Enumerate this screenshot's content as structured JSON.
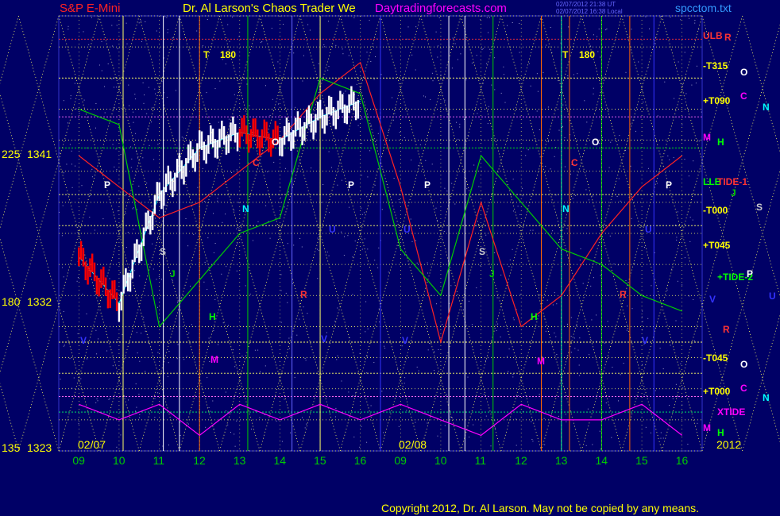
{
  "header": {
    "left_title": "S&P E-Mini",
    "center_title": "Dr. Al Larson's Chaos Trader We",
    "site": "Daytradingforecasts.com",
    "timestamp_line1": "02/07/2012 21:38 UT",
    "timestamp_line2": "02/07/2012 16:38 Local",
    "filename": "spcctom.txt"
  },
  "footer": {
    "copyright": "Copyright 2012, Dr. Al Larson. May not be copied by any means."
  },
  "colors": {
    "background": "#000066",
    "price_up": "#ffffff",
    "price_down": "#ff0000",
    "grid_dotted": "#ffff66",
    "cyan": "#00ffff",
    "green": "#00cc00",
    "magenta": "#ff00ff",
    "orange": "#ff6600",
    "white": "#ffffff"
  },
  "y_axis_labels": [
    {
      "angle": "225",
      "price": "1341"
    },
    {
      "angle": "180",
      "price": "1332"
    },
    {
      "angle": "135",
      "price": "1323"
    }
  ],
  "x_axis": {
    "day1_label": "02/07",
    "day2_label": "02/08",
    "year_label": "2012",
    "hour_ticks": [
      "09",
      "10",
      "11",
      "12",
      "13",
      "14",
      "15",
      "16",
      "09",
      "10",
      "11",
      "12",
      "13",
      "14",
      "15",
      "16"
    ]
  },
  "top_markers": [
    {
      "label": "T",
      "value": "180"
    },
    {
      "label": "T",
      "value": "180"
    }
  ],
  "right_labels": [
    {
      "text": "ULB",
      "color": "#ff3333"
    },
    {
      "text": "R",
      "color": "#ff3333"
    },
    {
      "text": "-T315",
      "color": "#ffff00"
    },
    {
      "text": "O",
      "color": "#ffffff"
    },
    {
      "text": "+T090",
      "color": "#ffff00"
    },
    {
      "text": "C",
      "color": "#ff00ff"
    },
    {
      "text": "N",
      "color": "#00ffff"
    },
    {
      "text": "M",
      "color": "#ff00ff"
    },
    {
      "text": "H",
      "color": "#00ff00"
    },
    {
      "text": "LLB",
      "color": "#00ff00"
    },
    {
      "text": "TIDE-1",
      "color": "#ff3333"
    },
    {
      "text": "J",
      "color": "#00cc00"
    },
    {
      "text": "-T000",
      "color": "#ffff00"
    },
    {
      "text": "S",
      "color": "#cccccc"
    },
    {
      "text": "+T045",
      "color": "#ffff00"
    },
    {
      "text": "+TIDE-2",
      "color": "#00ff00"
    },
    {
      "text": "P",
      "color": "#ffffff"
    },
    {
      "text": "V",
      "color": "#3333ff"
    },
    {
      "text": "U",
      "color": "#3333ff"
    },
    {
      "text": "R",
      "color": "#ff3333"
    },
    {
      "text": "-T045",
      "color": "#ffff00"
    },
    {
      "text": "O",
      "color": "#ffffff"
    },
    {
      "text": "+T000",
      "color": "#ffff00"
    },
    {
      "text": "C",
      "color": "#ff00ff"
    },
    {
      "text": "N",
      "color": "#00ffff"
    },
    {
      "text": "XTIDE",
      "color": "#ff00ff"
    },
    {
      "text": "M",
      "color": "#ff00ff"
    },
    {
      "text": "H",
      "color": "#00ff00"
    }
  ],
  "planet_markers": [
    {
      "text": "P",
      "color": "#ffffff"
    },
    {
      "text": "S",
      "color": "#cccccc"
    },
    {
      "text": "J",
      "color": "#00cc00"
    },
    {
      "text": "N",
      "color": "#00ffff"
    },
    {
      "text": "H",
      "color": "#00ff00"
    },
    {
      "text": "M",
      "color": "#ff00ff"
    },
    {
      "text": "V",
      "color": "#3333ff"
    },
    {
      "text": "O",
      "color": "#ffffff"
    },
    {
      "text": "C",
      "color": "#ff3333"
    },
    {
      "text": "U",
      "color": "#3333ff"
    },
    {
      "text": "R",
      "color": "#ff3333"
    },
    {
      "text": "V",
      "color": "#3333ff"
    },
    {
      "text": "P",
      "color": "#ffffff"
    },
    {
      "text": "P",
      "color": "#ffffff"
    },
    {
      "text": "U",
      "color": "#3333ff"
    },
    {
      "text": "V",
      "color": "#3333ff"
    },
    {
      "text": "S",
      "color": "#cccccc"
    },
    {
      "text": "J",
      "color": "#00cc00"
    },
    {
      "text": "H",
      "color": "#00ff00"
    },
    {
      "text": "M",
      "color": "#ff00ff"
    },
    {
      "text": "O",
      "color": "#ffffff"
    },
    {
      "text": "C",
      "color": "#ff3333"
    },
    {
      "text": "N",
      "color": "#00ffff"
    },
    {
      "text": "R",
      "color": "#ff3333"
    },
    {
      "text": "U",
      "color": "#3333ff"
    },
    {
      "text": "V",
      "color": "#3333ff"
    },
    {
      "text": "P",
      "color": "#ffffff"
    }
  ],
  "chart_data": {
    "type": "line",
    "title": "S&P E-Mini",
    "x": [
      "02/07 09",
      "02/07 10",
      "02/07 11",
      "02/07 12",
      "02/07 13",
      "02/07 14",
      "02/07 15",
      "02/07 16",
      "02/08 09",
      "02/08 10",
      "02/08 11",
      "02/08 12",
      "02/08 13",
      "02/08 14",
      "02/08 15",
      "02/08 16"
    ],
    "ylim": [
      1323,
      1351
    ],
    "series": [
      {
        "name": "price",
        "values": [
          1335.5,
          1332.5,
          1339.5,
          1342.5,
          1343.5,
          1343.0,
          1344.5,
          1345.5
        ]
      },
      {
        "name": "TIDE-1",
        "values": [
          1342,
          1340,
          1338,
          1339,
          1341,
          1343,
          1346,
          1348,
          1340,
          1330,
          1339,
          1331,
          1333,
          1337,
          1340,
          1342
        ]
      },
      {
        "name": "+TIDE-2",
        "values": [
          1345,
          1344,
          1331,
          1334,
          1337,
          1338,
          1347,
          1346,
          1336,
          1333,
          1342,
          1339,
          1336,
          1335,
          1333,
          1332
        ]
      },
      {
        "name": "XTIDE",
        "values": [
          1326,
          1325,
          1326,
          1324,
          1326,
          1325,
          1326,
          1325,
          1326,
          1325,
          1324,
          1326,
          1325,
          1325,
          1326,
          1324
        ]
      }
    ]
  }
}
